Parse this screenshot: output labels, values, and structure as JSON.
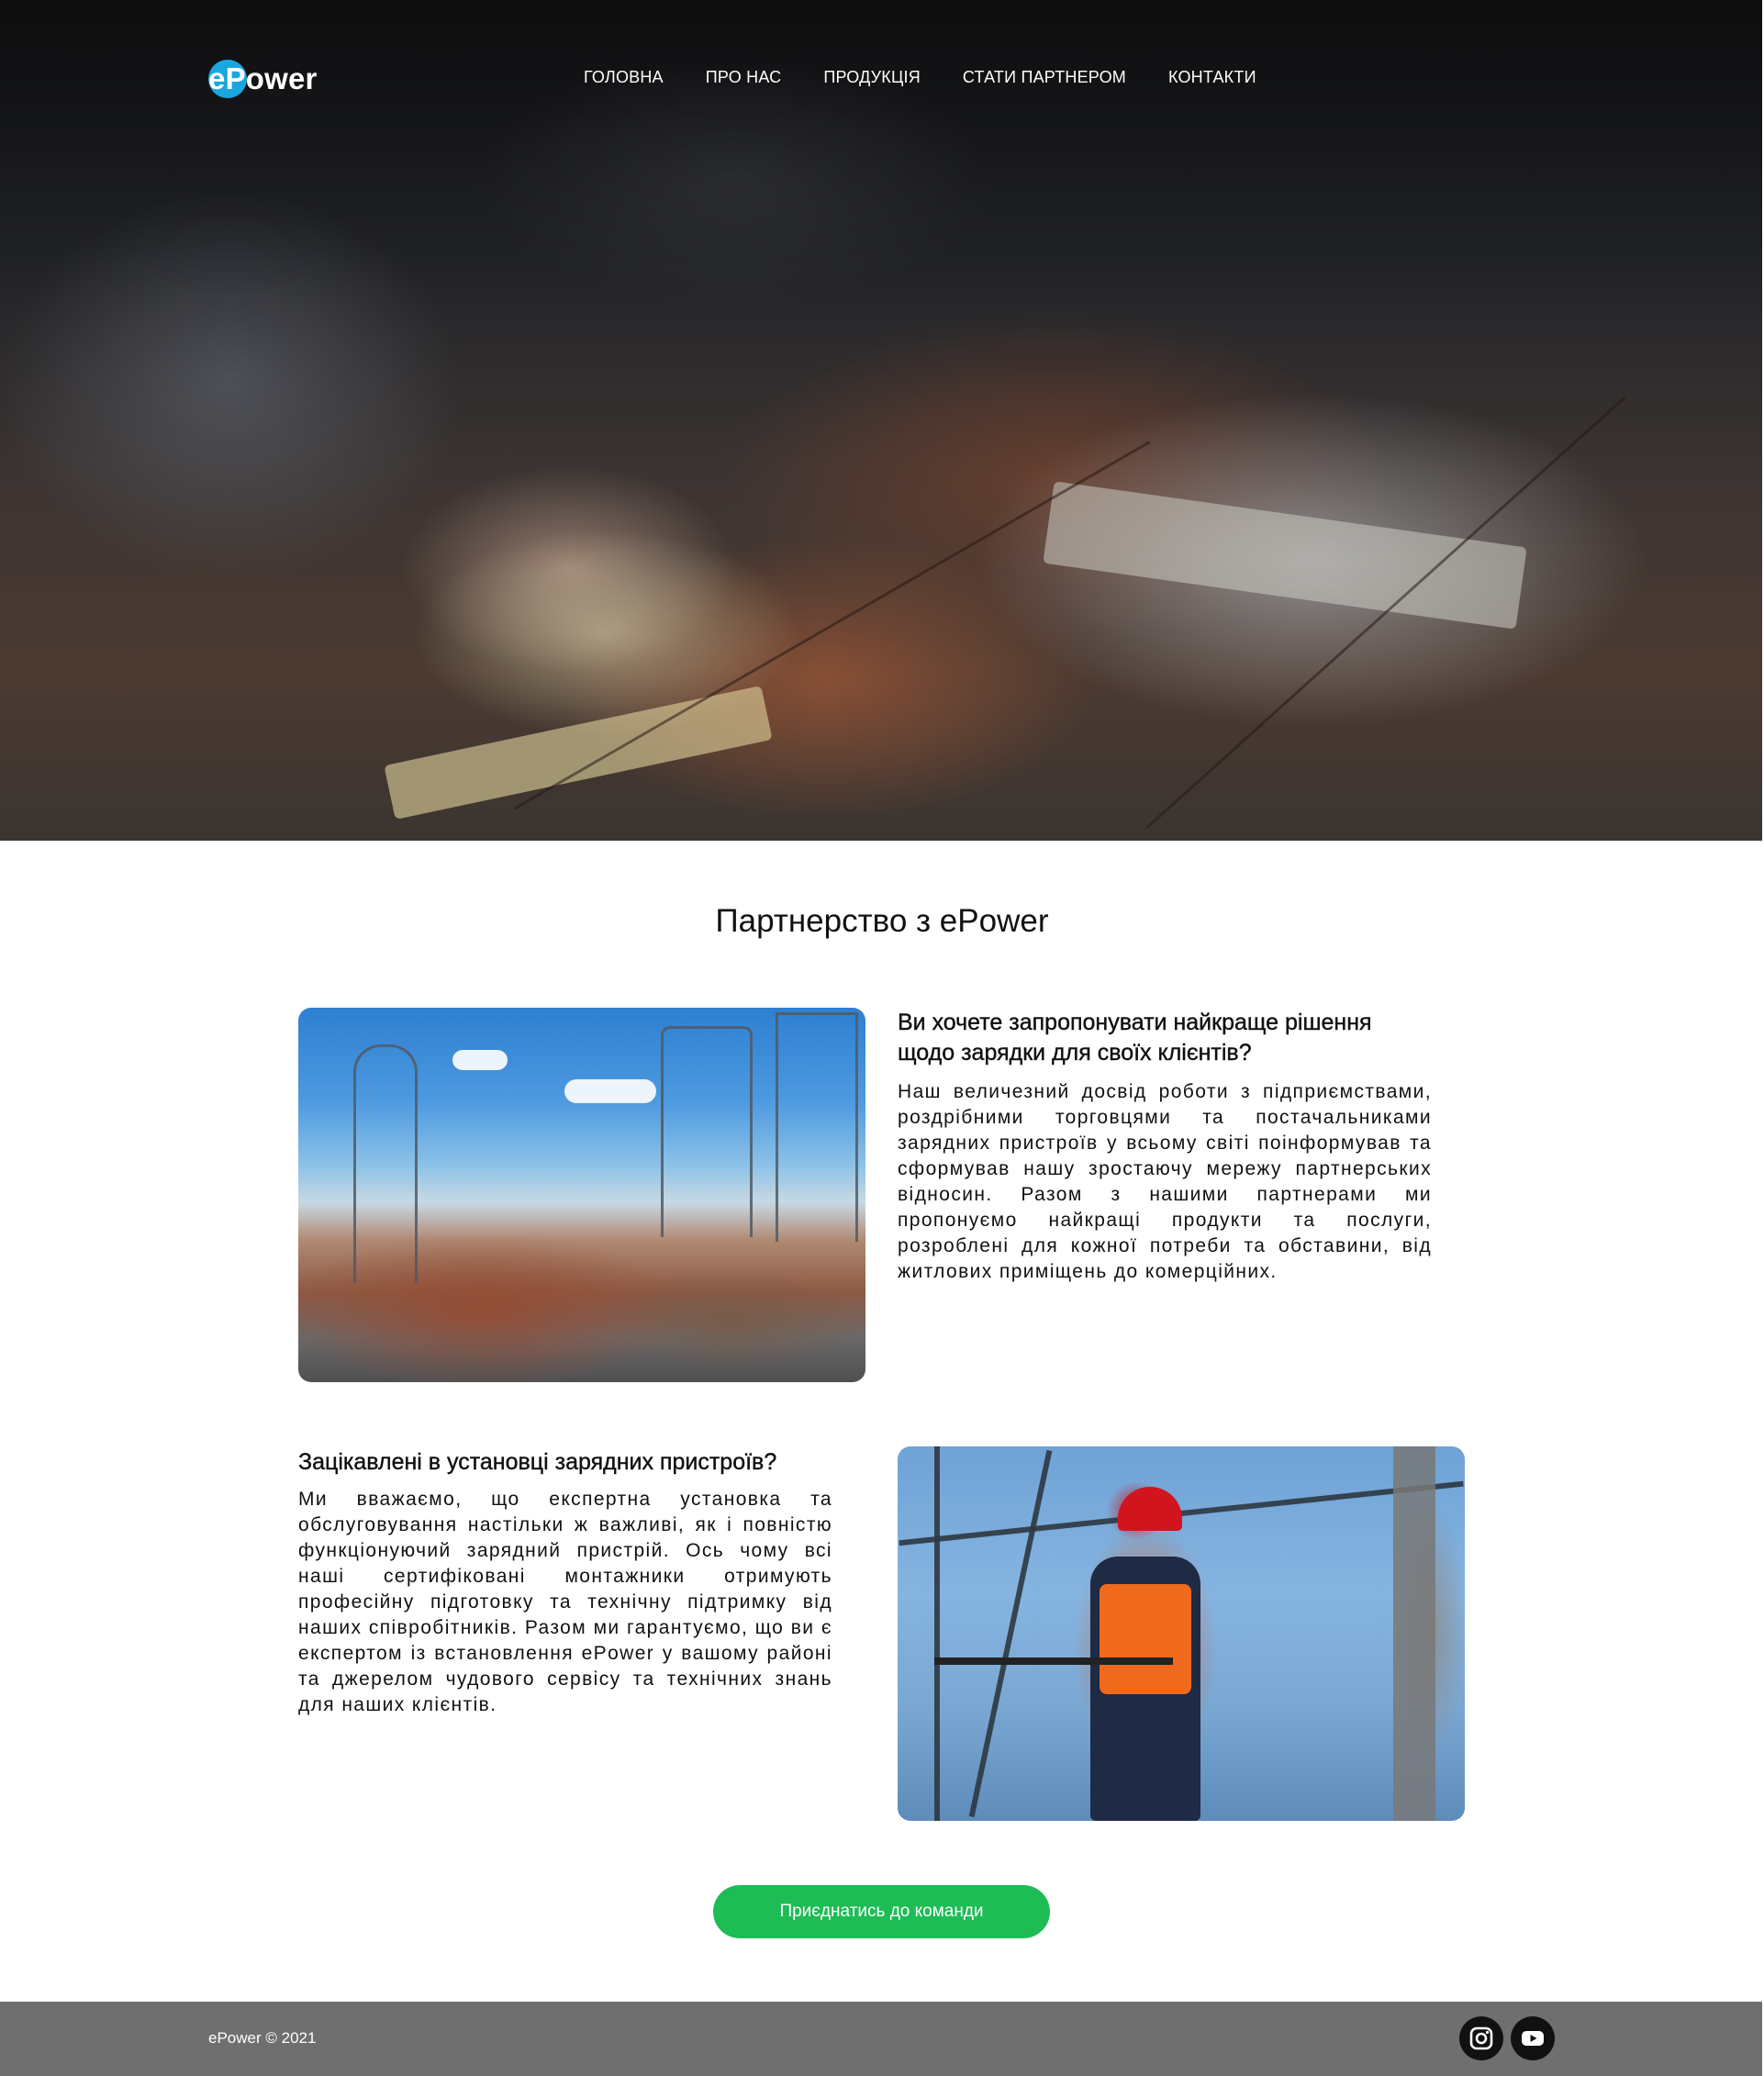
{
  "header": {
    "logo": {
      "prefix": "e",
      "rest": "Power"
    },
    "nav": [
      {
        "label": "ГОЛОВНА"
      },
      {
        "label": "ПРО НАС"
      },
      {
        "label": "ПРОДУКЦІЯ"
      },
      {
        "label": "СТАТИ ПАРТНЕРОМ"
      },
      {
        "label": "КОНТАКТИ"
      }
    ]
  },
  "main": {
    "title": "Партнерство з ePower",
    "blocks": [
      {
        "heading": "Ви хочете запропонувати найкраще рішення щодо зарядки для своїх клієнтів?",
        "text": "Наш величезний досвід роботи з підприємствами, роздрібними торговцями та постачальниками зарядних пристроїв у всьому світі поінформував та сформував нашу зростаючу мережу партнерських відносин. Разом з нашими партнерами ми пропонуємо найкращі продукти та послуги, розроблені для кожної потреби та обставини, від житлових приміщень до комерційних."
      },
      {
        "heading": "Зацікавлені в установці зарядних пристроїв?",
        "text": "Ми вважаємо, що експертна установка та обслуговування настільки ж важливі, як і повністю функціонуючий зарядний пристрій. Ось чому всі наші сертифіковані монтажники отримують професійну підготовку та технічну підтримку від наших співробітників. Разом ми гарантуємо, що ви є експертом із встановлення ePower у вашому районі та джерелом чудового сервісу та технічних знань для наших клієнтів."
      }
    ],
    "cta_label": "Приєднатись до команди"
  },
  "footer": {
    "copyright": "ePower © 2021",
    "social": [
      {
        "icon": "instagram-icon"
      },
      {
        "icon": "youtube-icon"
      }
    ]
  },
  "colors": {
    "accent": "#1ebc55",
    "logo_circle": "#1aa7e0",
    "footer_bg": "#6f6f6f"
  }
}
